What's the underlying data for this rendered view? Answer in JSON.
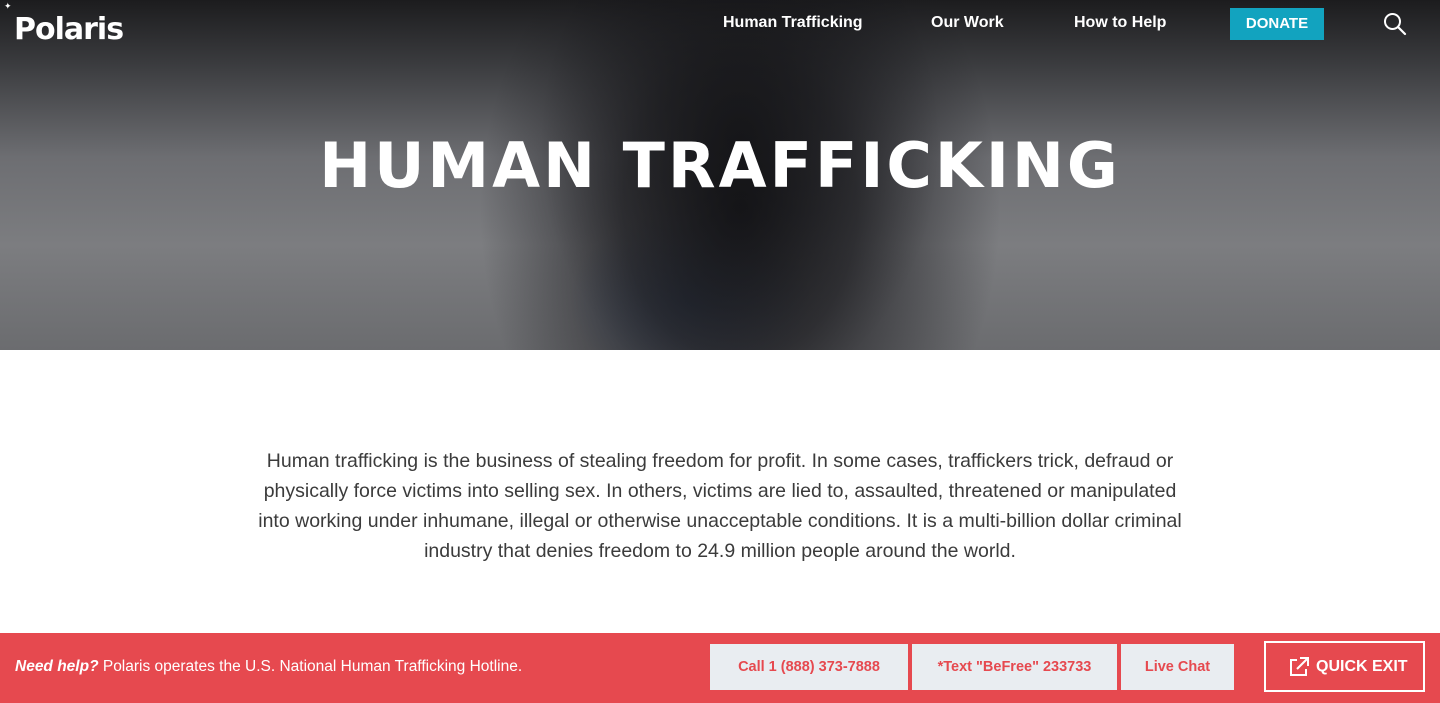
{
  "header": {
    "logo": "Polaris",
    "nav": [
      {
        "label": "Human Trafficking"
      },
      {
        "label": "Our Work"
      },
      {
        "label": "How to Help"
      }
    ],
    "donate_label": "DONATE",
    "search_icon": "search-icon"
  },
  "hero": {
    "title": "HUMAN TRAFFICKING"
  },
  "intro": {
    "text": "Human trafficking is the business of stealing freedom for profit. In some cases, traffickers trick, defraud or physically force victims into selling sex. In others, victims are lied to, assaulted, threatened or manipulated into working under inhumane, illegal or otherwise unacceptable conditions. It is a multi-billion dollar criminal industry that denies freedom to 24.9 million people around the world."
  },
  "helpbar": {
    "need_help": "Need help?",
    "message": " Polaris operates the U.S. National Human Trafficking Hotline.",
    "buttons": [
      {
        "label": "Call 1 (888) 373-7888"
      },
      {
        "label": "*Text \"BeFree\" 233733"
      },
      {
        "label": "Live Chat"
      }
    ],
    "quick_exit_label": "QUICK EXIT",
    "quick_exit_icon": "external-link-icon"
  },
  "colors": {
    "accent_red": "#e6494f",
    "donate_teal": "#12a3bf",
    "button_bg": "#e9edf1",
    "body_text": "#3b3b3b"
  }
}
